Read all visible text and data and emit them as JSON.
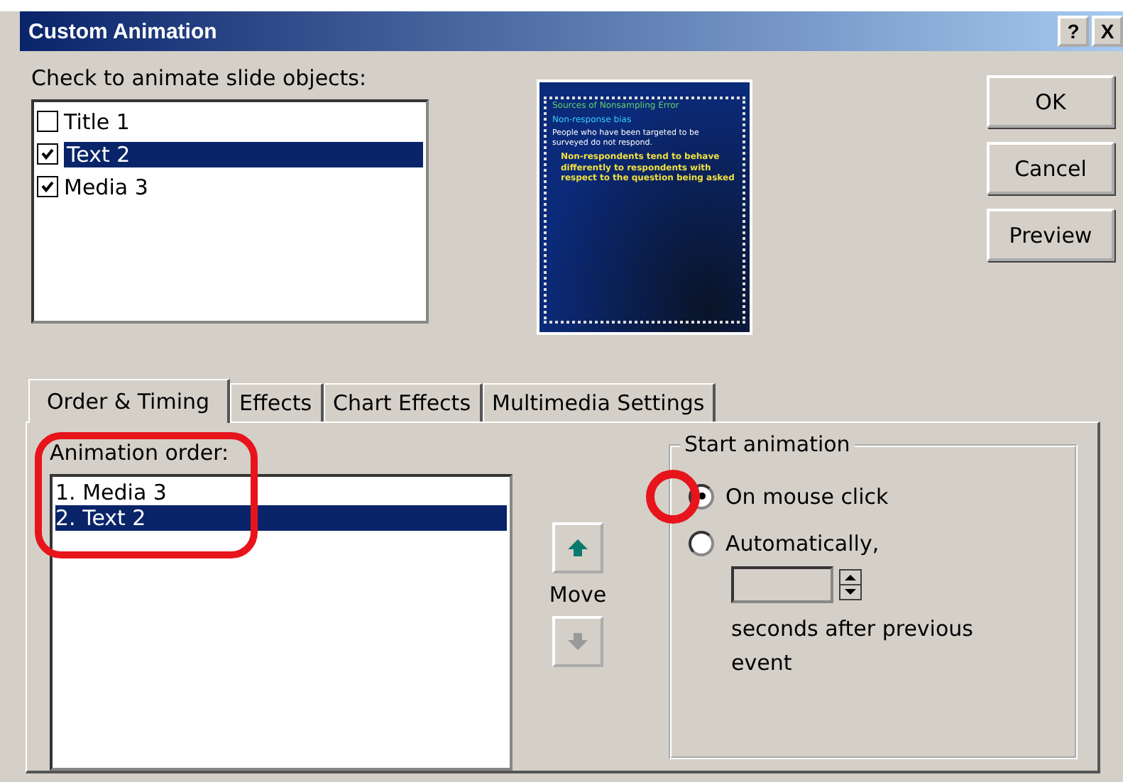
{
  "window": {
    "title": "Custom Animation",
    "help_button": "?",
    "close_button": "X"
  },
  "objects": {
    "label": "Check to animate slide objects:",
    "items": [
      {
        "name": "Title 1",
        "checked": false,
        "selected": false
      },
      {
        "name": "Text 2",
        "checked": true,
        "selected": true
      },
      {
        "name": "Media 3",
        "checked": true,
        "selected": false
      }
    ]
  },
  "preview": {
    "title": "Sources of Nonsampling Error",
    "heading": "Non-response bias",
    "body": "People who have been targeted to be surveyed do not respond.",
    "bullet": "Non-respondents tend to behave differently to respondents with respect to the question being asked"
  },
  "buttons": [
    {
      "label": "OK"
    },
    {
      "label": "Cancel"
    },
    {
      "label": "Preview"
    }
  ],
  "tabs": [
    {
      "label": "Order & Timing",
      "selected": true
    },
    {
      "label": "Effects",
      "selected": false
    },
    {
      "label": "Chart Effects",
      "selected": false
    },
    {
      "label": "Multimedia Settings",
      "selected": false
    }
  ],
  "animation_order": {
    "label": "Animation order:",
    "items": [
      {
        "text": "1. Media 3",
        "selected": false
      },
      {
        "text": "2. Text 2",
        "selected": true
      }
    ]
  },
  "move": {
    "label": "Move",
    "buttons": [
      {
        "kind": "up",
        "disabled": false
      },
      {
        "kind": "down",
        "disabled": true
      }
    ]
  },
  "start_animation": {
    "label": "Start animation",
    "options": [
      {
        "label": "On mouse click",
        "selected": true
      },
      {
        "label": "Automatically,",
        "selected": false
      }
    ],
    "seconds_field": {
      "disabled": true
    },
    "after_text": "seconds after previous event"
  }
}
